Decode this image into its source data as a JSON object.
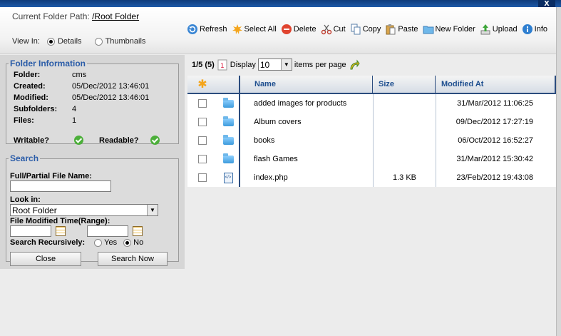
{
  "window": {
    "close_label": "x"
  },
  "header": {
    "path_label": "Current Folder Path:",
    "path_value": "/Root Folder",
    "view_in_label": "View In:",
    "view_details": "Details",
    "view_thumbnails": "Thumbnails",
    "selected_view": "Details"
  },
  "toolbar": [
    {
      "name": "refresh",
      "label": "Refresh",
      "icon": "refresh-icon"
    },
    {
      "name": "select-all",
      "label": "Select All",
      "icon": "select-all-icon"
    },
    {
      "name": "delete",
      "label": "Delete",
      "icon": "delete-icon"
    },
    {
      "name": "cut",
      "label": "Cut",
      "icon": "scissors-icon"
    },
    {
      "name": "copy",
      "label": "Copy",
      "icon": "copy-icon"
    },
    {
      "name": "paste",
      "label": "Paste",
      "icon": "paste-icon"
    },
    {
      "name": "new-folder",
      "label": "New Folder",
      "icon": "new-folder-icon"
    },
    {
      "name": "upload",
      "label": "Upload",
      "icon": "upload-icon"
    },
    {
      "name": "info",
      "label": "Info",
      "icon": "info-icon"
    }
  ],
  "folder_info": {
    "legend": "Folder Information",
    "rows": [
      {
        "key": "Folder:",
        "value": "cms"
      },
      {
        "key": "Created:",
        "value": "05/Dec/2012 13:46:01"
      },
      {
        "key": "Modified:",
        "value": "05/Dec/2012 13:46:01"
      },
      {
        "key": "Subfolders:",
        "value": "4"
      },
      {
        "key": "Files:",
        "value": "1"
      }
    ],
    "writable_label": "Writable?",
    "readable_label": "Readable?"
  },
  "search": {
    "legend": "Search",
    "filename_label": "Full/Partial File Name:",
    "filename_value": "",
    "look_in_label": "Look in:",
    "look_in_value": "Root Folder",
    "modified_label": "File Modified Time(Range):",
    "recursive_label": "Search Recursively:",
    "yes_label": "Yes",
    "no_label": "No",
    "recursive_selected": "No",
    "close_button": "Close",
    "search_button": "Search Now"
  },
  "pager": {
    "count": "1/5 (5)",
    "display_label": "Display",
    "per_page_value": "10",
    "per_page_suffix": "items per page"
  },
  "grid": {
    "columns": {
      "name": "Name",
      "size": "Size",
      "modified": "Modified At"
    },
    "rows": [
      {
        "type": "folder",
        "name": "added images for products",
        "size": "",
        "modified": "31/Mar/2012 11:06:25"
      },
      {
        "type": "folder",
        "name": "Album covers",
        "size": "",
        "modified": "09/Dec/2012 17:27:19"
      },
      {
        "type": "folder",
        "name": "books",
        "size": "",
        "modified": "06/Oct/2012 16:52:27"
      },
      {
        "type": "folder",
        "name": "flash Games",
        "size": "",
        "modified": "31/Mar/2012 15:30:42"
      },
      {
        "type": "file",
        "name": "index.php",
        "size": "1.3 KB",
        "modified": "23/Feb/2012 19:43:08"
      }
    ]
  },
  "colors": {
    "accent": "#2a5ca8",
    "grid_border": "#2b4c7e",
    "check": "#4caf3a"
  }
}
